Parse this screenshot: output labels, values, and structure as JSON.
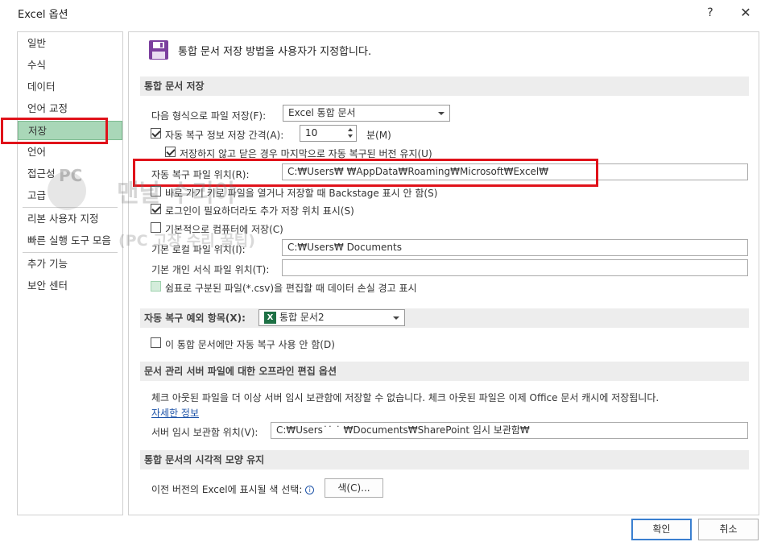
{
  "window": {
    "title": "Excel 옵션",
    "help": "?",
    "close": "✕"
  },
  "sidebar": {
    "items": [
      {
        "label": "일반"
      },
      {
        "label": "수식"
      },
      {
        "label": "데이터"
      },
      {
        "label": "언어 교정"
      },
      {
        "label": "저장",
        "selected": true
      },
      {
        "label": "언어"
      },
      {
        "label": "접근성"
      },
      {
        "label": "고급"
      },
      {
        "label": "리본 사용자 지정"
      },
      {
        "label": "빠른 실행 도구 모음"
      },
      {
        "label": "추가 기능"
      },
      {
        "label": "보안 센터"
      }
    ]
  },
  "main": {
    "header": "통합 문서 저장 방법을 사용자가 지정합니다.",
    "save_section": {
      "title": "통합 문서 저장",
      "format_label": "다음 형식으로 파일 저장(F):",
      "format_value": "Excel 통합 문서",
      "autorecover_label": "자동 복구 정보 저장 간격(A):",
      "autorecover_checked": true,
      "autorecover_minutes": "10",
      "minutes_label": "분(M)",
      "keep_last_label": "저장하지 않고 닫은 경우 마지막으로 자동 복구된 버전 유지(U)",
      "keep_last_checked": true,
      "autorecover_location_label": "자동 복구 파일 위치(R):",
      "autorecover_location_value": "C:₩Users₩          ₩AppData₩Roaming₩Microsoft₩Excel₩",
      "backstage_label": "바로 가기 키로 파일을 열거나 저장할 때 Backstage 표시 안 함(S)",
      "backstage_checked": false,
      "show_more_label": "로그인이 필요하더라도 추가 저장 위치 표시(S)",
      "show_more_checked": true,
      "default_computer_label": "기본적으로 컴퓨터에 저장(C)",
      "default_computer_checked": false,
      "default_local_label": "기본 로컬 파일 위치(I):",
      "default_local_value": "C:₩Users₩             Documents",
      "personal_template_label": "기본 개인 서식 파일 위치(T):",
      "personal_template_value": "",
      "csv_warning_label": "쉼표로 구분된 파일(*.csv)을 편집할 때 데이터 손실 경고 표시",
      "csv_warning_checked": false
    },
    "exceptions_section": {
      "title": "자동 복구 예외 항목(X):",
      "workbook_value": "통합 문서2",
      "xl_icon": "X",
      "disable_label": "이 통합 문서에만 자동 복구 사용 안 함(D)",
      "disable_checked": false
    },
    "offline_section": {
      "title": "문서 관리 서버 파일에 대한 오프라인 편집 옵션",
      "description": "체크 아웃된 파일을 더 이상 서버 임시 보관함에 저장할 수 없습니다. 체크 아웃된 파일은 이제 Office 문서 캐시에 저장됩니다.",
      "more_info_link": "자세한 정보",
      "drafts_label": "서버 임시 보관함 위치(V):",
      "drafts_value": "C:₩Users˙˙      ˙ ₩Documents₩SharePoint 임시 보관함₩"
    },
    "visual_section": {
      "title": "통합 문서의 시각적 모양 유지",
      "colors_label": "이전 버전의 Excel에 표시될 색 선택:",
      "info_icon": "i",
      "colors_button": "색(C)..."
    }
  },
  "footer": {
    "ok": "확인",
    "cancel": "취소"
  },
  "watermark": {
    "line1": "PC",
    "line2": "맨날 수리야",
    "line3": "(PC 고장 수리 꿀팁)"
  },
  "colors": {
    "accent_green": "#a9d7b8",
    "highlight_red": "#e0121a",
    "save_icon_purple": "#7b3f9e",
    "link_blue": "#1d53a8"
  }
}
